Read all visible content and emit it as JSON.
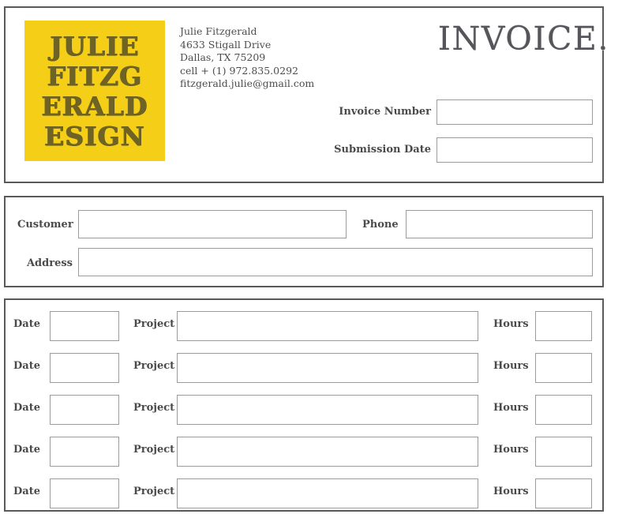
{
  "document": {
    "title": "INVOICE.",
    "accent_color": "#F5CE17",
    "border_color": "#5a5a5a",
    "field_border_color": "#9b9b9b",
    "text_color": "#4a4a4a"
  },
  "logo": {
    "lines": [
      "JULIE",
      "FITZG",
      "ERALD",
      "ESIGN"
    ],
    "background_color": "#F5CE17",
    "text_color": "#6e6324"
  },
  "contact": {
    "name": "Julie Fitzgerald",
    "street": "4633 Stigall Drive",
    "city_state_zip": "Dallas, TX 75209",
    "phone": "cell + (1) 972.835.0292",
    "email": "fitzgerald.julie@gmail.com"
  },
  "header_fields": {
    "invoice_number": {
      "label": "Invoice Number",
      "value": "",
      "placeholder": ""
    },
    "submission_date": {
      "label": "Submission Date",
      "value": "",
      "placeholder": ""
    }
  },
  "client_fields": {
    "customer": {
      "label": "Customer",
      "value": "",
      "placeholder": ""
    },
    "phone": {
      "label": "Phone",
      "value": "",
      "placeholder": ""
    },
    "address": {
      "label": "Address",
      "value": "",
      "placeholder": ""
    }
  },
  "line_items": {
    "labels": {
      "date": "Date",
      "project": "Project",
      "hours": "Hours"
    },
    "rows": [
      {
        "date": "",
        "project": "",
        "hours": ""
      },
      {
        "date": "",
        "project": "",
        "hours": ""
      },
      {
        "date": "",
        "project": "",
        "hours": ""
      },
      {
        "date": "",
        "project": "",
        "hours": ""
      },
      {
        "date": "",
        "project": "",
        "hours": ""
      }
    ]
  }
}
